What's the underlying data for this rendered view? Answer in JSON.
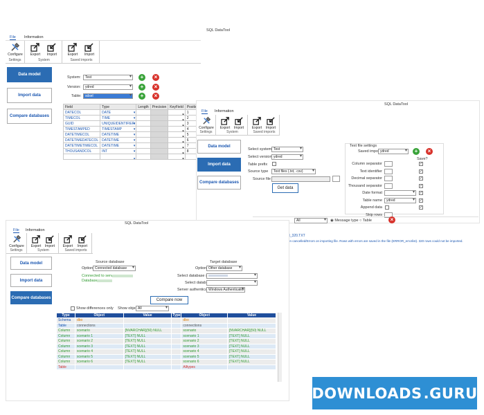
{
  "window_main": {
    "title": "SQL DataTool",
    "menu": [
      "File",
      "Information"
    ],
    "ribbon": {
      "groups": [
        {
          "label": "Settings",
          "buttons": [
            {
              "label": "Configure",
              "icon": "wrench-icon"
            }
          ]
        },
        {
          "label": "System",
          "buttons": [
            {
              "label": "Export",
              "icon": "export-icon"
            },
            {
              "label": "Import",
              "icon": "import-icon"
            }
          ]
        },
        {
          "label": "Saved imports",
          "buttons": [
            {
              "label": "Export",
              "icon": "export-icon"
            },
            {
              "label": "Import",
              "icon": "import-icon"
            }
          ]
        }
      ]
    },
    "nav": [
      "Data model",
      "Import data",
      "Compare databases"
    ],
    "form": {
      "system_label": "System:",
      "system_value": "Test",
      "version_label": "Version:",
      "version_value": "ydred",
      "table_label": "Table:",
      "table_value": "sdsel"
    },
    "grid": {
      "headers": [
        "Field",
        "Type",
        "Length",
        "Precision",
        "KeyField",
        "Position"
      ],
      "rows": [
        {
          "field": "DATECOL",
          "type": "DATE",
          "key": "",
          "pos": "1"
        },
        {
          "field": "TIMECOL",
          "type": "TIME",
          "key": "",
          "pos": "2"
        },
        {
          "field": "GUID",
          "type": "UNIQUEIDENTIFIER",
          "key": "",
          "pos": "3"
        },
        {
          "field": "TIMESTAMPED",
          "type": "TIMESTAMP",
          "key": "",
          "pos": "4"
        },
        {
          "field": "DATETIMECOL",
          "type": "DATETIME",
          "key": "",
          "pos": "5"
        },
        {
          "field": "DATETIMEDATECOL",
          "type": "DATETIME",
          "key": "",
          "pos": "6"
        },
        {
          "field": "DATETIMETIMECOL",
          "type": "DATETIME",
          "key": "",
          "pos": "7"
        },
        {
          "field": "THOUSANDCOL",
          "type": "INT",
          "key": "",
          "pos": "8"
        },
        {
          "field": "",
          "type": "",
          "key": "",
          "pos": ""
        }
      ]
    }
  },
  "window_import": {
    "title": "SQL DataTool",
    "menu": [
      "File",
      "Information"
    ],
    "nav": [
      "Data model",
      "Import data",
      "Compare databases"
    ],
    "form": {
      "select_system_label": "Select system",
      "select_system_value": "Test",
      "select_version_label": "Select version",
      "select_version_value": "ydred",
      "table_prefix_label": "Table prefix",
      "source_type_label": "Source type",
      "source_type_value": "Text files (.txt, .csv)",
      "source_file_label": "Source file",
      "get_data_label": "Get data"
    },
    "text_settings": {
      "title": "Text file settings",
      "saved_imports_label": "Saved imports",
      "saved_imports_value": "ydred",
      "save_header": "Save?",
      "rows": [
        "Column separator",
        "Text identifier",
        "Decimal separator",
        "Thousand separator",
        "Date format",
        "Table name",
        "Append data",
        "Skip rows"
      ],
      "table_name_value": "ydred"
    },
    "bottom": {
      "filter_value": "All",
      "message_type_label": "Message type",
      "table_label": "Table"
    },
    "log": {
      "line1": "\\I_320.TXT",
      "line2": "en cancelled/Errors on importing file. Rows with errors are saved in the file (ERROR_errorlist). 320 rows could not be imported."
    }
  },
  "window_compare": {
    "title": "SQL DataTool",
    "menu": [
      "File",
      "Information"
    ],
    "nav": [
      "Data model",
      "Import data",
      "Compare databases"
    ],
    "source": {
      "header": "Source database",
      "options_label": "Options",
      "options_value": "Connected database",
      "connected_label": "Connected to server:",
      "database_label": "Database:"
    },
    "target": {
      "header": "Target database",
      "options_label": "Options",
      "options_value": "Other database",
      "select_server_label": "Select database server",
      "select_db_label": "Select database",
      "auth_label": "Server authentication",
      "auth_value": "Windows Authentication"
    },
    "compare_button": "Compare now",
    "show_diff_label": "Show differences only",
    "show_objects_label": "Show objects",
    "show_objects_value": "All",
    "table": {
      "headers": [
        "Type",
        "Object",
        "Value",
        "Type",
        "Object",
        "Value"
      ],
      "rows": [
        {
          "c1": "Schema",
          "c2": "dbo",
          "c3": "",
          "c4": "",
          "c5": "dbo",
          "c6": "",
          "k1": "t-blue",
          "k2": "t-orange",
          "k5": "t-orange"
        },
        {
          "c1": "Table",
          "c2": "connections",
          "c3": "",
          "c4": "",
          "c5": "connections",
          "c6": "",
          "k1": "t-blue",
          "k2": "t-gray",
          "k5": "t-gray"
        },
        {
          "c1": "Column",
          "c2": "scenario",
          "c3": "[NVARCHAR](50) NULL",
          "c4": "",
          "c5": "scenario",
          "c6": "[NVARCHAR](50) NULL",
          "k1": "t-green",
          "k2": "t-green",
          "k5": "t-green"
        },
        {
          "c1": "Column",
          "c2": "scenario 1",
          "c3": "[TEXT] NULL",
          "c4": "",
          "c5": "scenario 1",
          "c6": "[TEXT] NULL",
          "k1": "t-green",
          "k2": "t-green",
          "k5": "t-green"
        },
        {
          "c1": "Column",
          "c2": "scenario 2",
          "c3": "[TEXT] NULL",
          "c4": "",
          "c5": "scenario 2",
          "c6": "[TEXT] NULL",
          "k1": "t-green",
          "k2": "t-green",
          "k5": "t-green"
        },
        {
          "c1": "Column",
          "c2": "scenario 3",
          "c3": "[TEXT] NULL",
          "c4": "",
          "c5": "scenario 3",
          "c6": "[TEXT] NULL",
          "k1": "t-green",
          "k2": "t-green",
          "k5": "t-green"
        },
        {
          "c1": "Column",
          "c2": "scenario 4",
          "c3": "[TEXT] NULL",
          "c4": "",
          "c5": "scenario 4",
          "c6": "[TEXT] NULL",
          "k1": "t-green",
          "k2": "t-green",
          "k5": "t-green"
        },
        {
          "c1": "Column",
          "c2": "scenario 5",
          "c3": "[TEXT] NULL",
          "c4": "",
          "c5": "scenario 5",
          "c6": "[TEXT] NULL",
          "k1": "t-green",
          "k2": "t-green",
          "k5": "t-green"
        },
        {
          "c1": "Column",
          "c2": "scenario 6",
          "c3": "[TEXT] NULL",
          "c4": "",
          "c5": "scenario 6",
          "c6": "[TEXT] NULL",
          "k1": "t-green",
          "k2": "t-green",
          "k5": "t-green"
        },
        {
          "c1": "Table",
          "c2": "",
          "c3": "",
          "c4": "",
          "c5": "Alltypes",
          "c6": "",
          "k1": "t-red",
          "k2": "t-red",
          "k5": "t-red"
        }
      ]
    }
  },
  "watermark": {
    "text_left": "DOWNLOADS",
    "text_right": ".GURU"
  },
  "colors": {
    "accent": "#2b6cb3",
    "green": "#3aa33a",
    "red": "#d8322b",
    "header_blue": "#1f4e9c",
    "watermark": "#2e8fd4"
  }
}
